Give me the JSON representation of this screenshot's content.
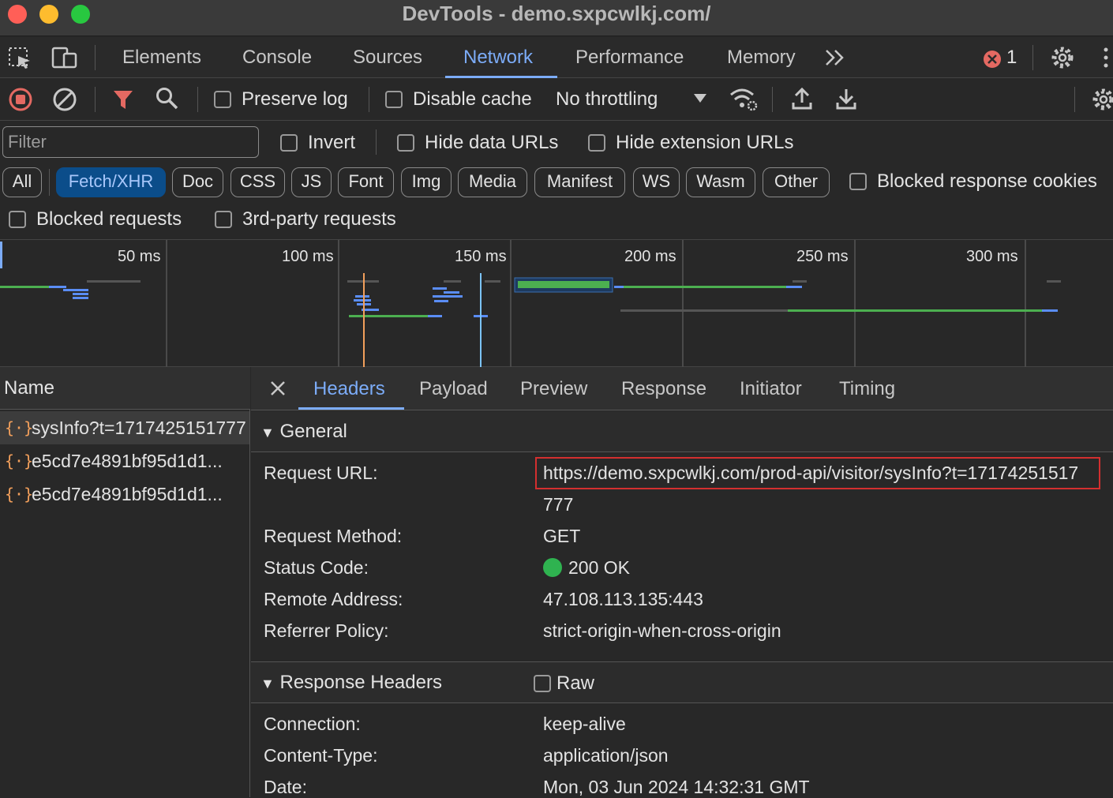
{
  "window": {
    "title": "DevTools - demo.sxpcwlkj.com/"
  },
  "main_tabs": [
    "Elements",
    "Console",
    "Sources",
    "Network",
    "Performance",
    "Memory"
  ],
  "active_main_tab": "Network",
  "error_count": "1",
  "toolbar": {
    "preserve_log": "Preserve log",
    "disable_cache": "Disable cache",
    "throttling": "No throttling"
  },
  "filter": {
    "placeholder": "Filter",
    "invert": "Invert",
    "hide_data_urls": "Hide data URLs",
    "hide_extension_urls": "Hide extension URLs",
    "types": [
      "All",
      "Fetch/XHR",
      "Doc",
      "CSS",
      "JS",
      "Font",
      "Img",
      "Media",
      "Manifest",
      "WS",
      "Wasm",
      "Other"
    ],
    "active_type": "Fetch/XHR",
    "blocked_response_cookies": "Blocked response cookies",
    "blocked_requests": "Blocked requests",
    "third_party_requests": "3rd-party requests"
  },
  "overview": {
    "ticks": [
      "50 ms",
      "100 ms",
      "150 ms",
      "200 ms",
      "250 ms",
      "300 ms"
    ]
  },
  "requests": {
    "header": "Name",
    "rows": [
      "sysInfo?t=1717425151777",
      "e5cd7e4891bf95d1d1...",
      "e5cd7e4891bf95d1d1..."
    ]
  },
  "detail_tabs": [
    "Headers",
    "Payload",
    "Preview",
    "Response",
    "Initiator",
    "Timing"
  ],
  "active_detail_tab": "Headers",
  "general": {
    "title": "General",
    "request_url_label": "Request URL:",
    "request_url": "https://demo.sxpcwlkj.com/prod-api/visitor/sysInfo?t=17174251517",
    "request_url_cont": "777",
    "method_label": "Request Method:",
    "method": "GET",
    "status_label": "Status Code:",
    "status": "200 OK",
    "status_color": "#2fb350",
    "remote_label": "Remote Address:",
    "remote": "47.108.113.135:443",
    "referrer_label": "Referrer Policy:",
    "referrer": "strict-origin-when-cross-origin"
  },
  "response_headers": {
    "title": "Response Headers",
    "raw_label": "Raw",
    "connection_label": "Connection:",
    "connection": "keep-alive",
    "content_type_label": "Content-Type:",
    "content_type": "application/json",
    "date_label": "Date:",
    "date": "Mon, 03 Jun 2024 14:32:31 GMT"
  }
}
